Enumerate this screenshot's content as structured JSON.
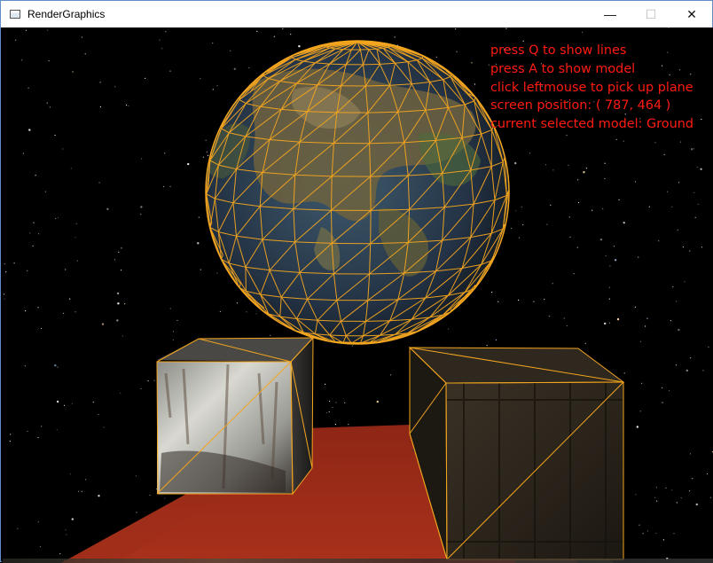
{
  "window": {
    "title": "RenderGraphics",
    "app_icon": "window-app-icon",
    "minimize_icon": "minimize-icon",
    "maximize_icon": "maximize-icon",
    "close_icon": "close-icon",
    "minimize_glyph": "—",
    "maximize_glyph": "☐",
    "close_glyph": "✕"
  },
  "hud": {
    "line1": "press Q to show lines",
    "line2": "press A to show model",
    "line3": "click leftmouse to pick up plane",
    "line4": "screen position: ( 787, 464 )",
    "line5": "current selected model: Ground"
  },
  "colors": {
    "hud_text": "#ff1b12",
    "wireframe": "#f3a51f",
    "background": "#000000"
  },
  "scene": {
    "objects": [
      "earth-globe-wireframe",
      "metal-cube",
      "wooden-crate",
      "red-ground-plane"
    ]
  }
}
